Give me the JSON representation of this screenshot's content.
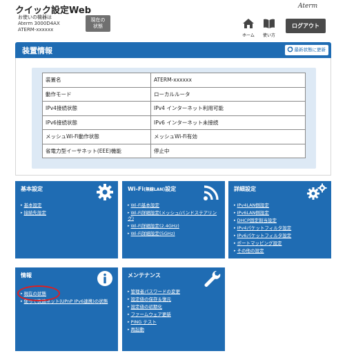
{
  "header": {
    "app_title": "クイック設定Web",
    "device_line1": "お使いの機器は",
    "device_line2": "Aterm 3000D4AX",
    "device_line3": "ATERM-xxxxxx",
    "status_btn_line1": "現在の",
    "status_btn_line2": "状態",
    "home_label": "ホーム",
    "manual_label": "使い方",
    "logout_label": "ログアウト",
    "brand": "Aterm"
  },
  "panel": {
    "title": "装置情報",
    "refresh_label": "最新状態に更新",
    "rows": [
      {
        "key": "装置名",
        "value": "ATERM-xxxxxx"
      },
      {
        "key": "動作モード",
        "value": "ローカルルータ"
      },
      {
        "key": "IPv4接続状態",
        "value": "IPv4 インターネット利用可能"
      },
      {
        "key": "IPv6接続状態",
        "value": "IPv6 インターネット未接続"
      },
      {
        "key": "メッシュWi-Fi動作状態",
        "value": "メッシュWi-Fi有効"
      },
      {
        "key": "省電力型イーサネット(EEE)機能",
        "value": "停止中"
      }
    ]
  },
  "cards": {
    "basic": {
      "title": "基本設定",
      "links": [
        "基本設定",
        "接続先設定"
      ]
    },
    "wifi": {
      "title_main": "Wi-Fi",
      "title_small": "(無線LAN)",
      "title_end": "設定",
      "links": [
        "Wi-Fi基本設定",
        "Wi-Fi詳細設定(メッシュ/バンドステアリング)",
        "Wi-Fi詳細設定(2.4GHz)",
        "Wi-Fi詳細設定(5GHz)"
      ]
    },
    "advanced": {
      "title": "詳細設定",
      "links": [
        "IPv4LAN側設定",
        "IPv6LAN側設定",
        "DHCP固定割当設定",
        "IPv4パケットフィルタ設定",
        "IPv6パケットフィルタ設定",
        "ポートマッピング設定",
        "その他の設定"
      ]
    },
    "info": {
      "title": "情報",
      "links": [
        "現在の状態",
        "使って快適ネット(UPnP IPv6連携)の状態"
      ]
    },
    "maintenance": {
      "title": "メンテナンス",
      "links": [
        "管理者パスワードの変更",
        "設定値の保存＆復元",
        "設定値の初期化",
        "ファームウェア更新",
        "PING テスト",
        "再起動"
      ]
    }
  },
  "colors": {
    "primary_blue": "#1f6cb3",
    "info_bg": "#dde9f5",
    "highlight_red": "#e11e1e"
  }
}
